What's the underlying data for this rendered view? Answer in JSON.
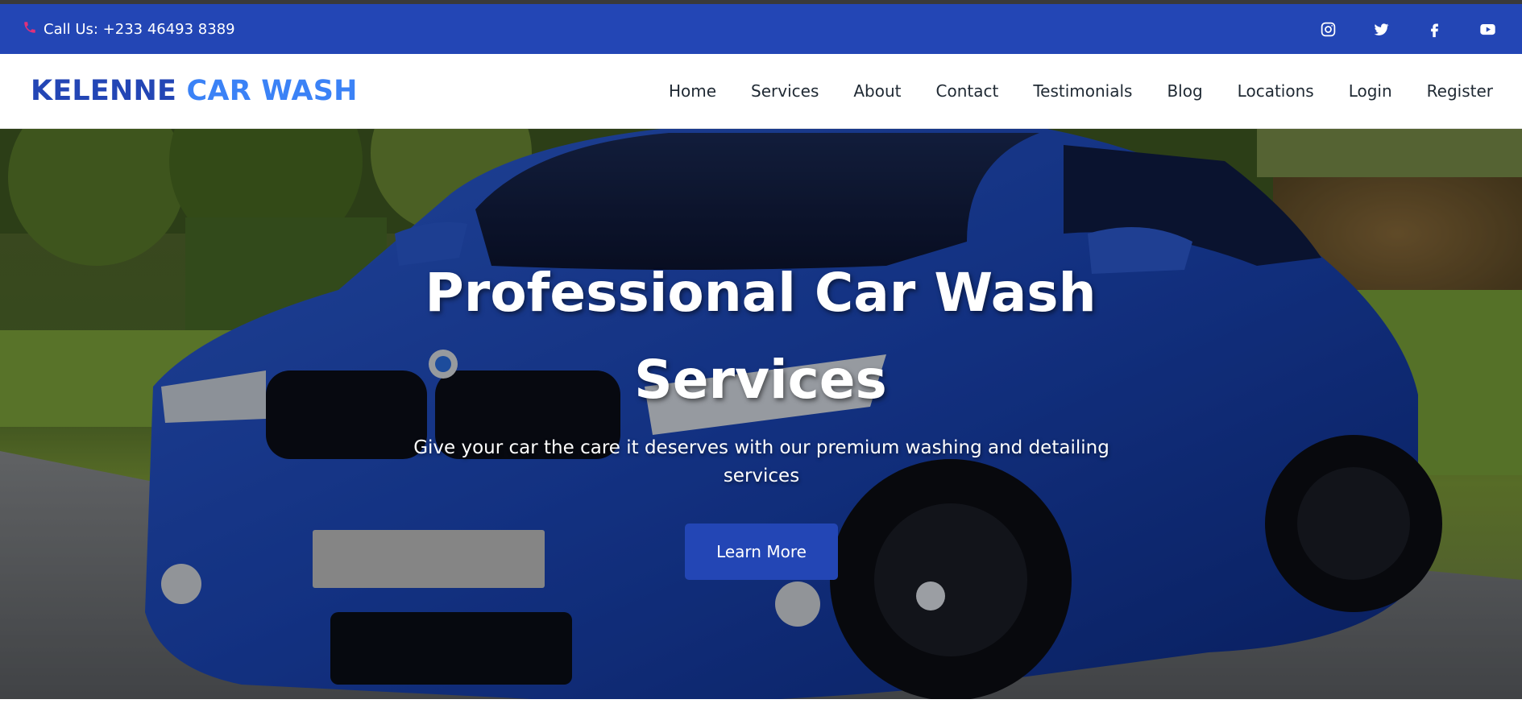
{
  "topbar": {
    "phone_icon": "phone-icon",
    "contact_text": "Call Us: +233 46493 8389",
    "socials": [
      "instagram-icon",
      "twitter-icon",
      "facebook-icon",
      "youtube-icon"
    ]
  },
  "brand": {
    "part1": "KELENNE",
    "part2": "CAR WASH"
  },
  "nav": {
    "items": [
      "Home",
      "Services",
      "About",
      "Contact",
      "Testimonials",
      "Blog",
      "Locations",
      "Login",
      "Register"
    ]
  },
  "hero": {
    "title": "Professional Car Wash Services",
    "subtitle": "Give your car the care it deserves with our premium washing and detailing services",
    "button": "Learn More"
  },
  "colors": {
    "primary": "#2346b5",
    "accent": "#3b82f6",
    "phone_icon": "#e0307a"
  }
}
